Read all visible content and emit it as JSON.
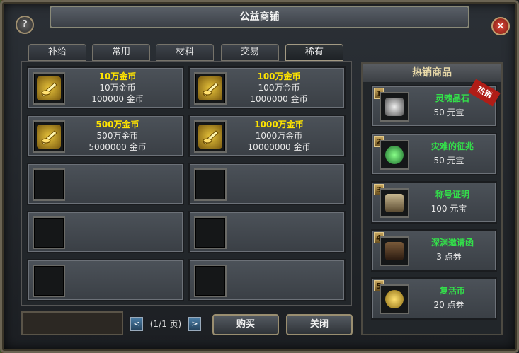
{
  "window": {
    "title": "公益商铺",
    "help_label": "?",
    "close_label": "✕"
  },
  "tabs": [
    {
      "label": "补给",
      "active": false
    },
    {
      "label": "常用",
      "active": false
    },
    {
      "label": "材料",
      "active": false
    },
    {
      "label": "交易",
      "active": false
    },
    {
      "label": "稀有",
      "active": true
    }
  ],
  "slots": [
    {
      "name": "10万金币",
      "sub": "10万金币",
      "price": "100000 金币",
      "icon": "gold-coin-icon"
    },
    {
      "name": "100万金币",
      "sub": "100万金币",
      "price": "1000000 金币",
      "icon": "gold-coin-icon"
    },
    {
      "name": "500万金币",
      "sub": "500万金币",
      "price": "5000000 金币",
      "icon": "gold-coin-icon"
    },
    {
      "name": "1000万金币",
      "sub": "1000万金币",
      "price": "10000000 金币",
      "icon": "gold-coin-icon"
    },
    {},
    {},
    {},
    {},
    {},
    {}
  ],
  "hot": {
    "title": "热销商品",
    "badge": "热销",
    "items": [
      {
        "rank": "1",
        "name": "灵魂晶石",
        "price": "50 元宝",
        "icon": "crystal-icon",
        "color": "#9aa1a8"
      },
      {
        "rank": "2",
        "name": "灾难的征兆",
        "price": "50 元宝",
        "icon": "green-orb-icon",
        "color": "#2fa84a"
      },
      {
        "rank": "3",
        "name": "称号证明",
        "price": "100 元宝",
        "icon": "anvil-icon",
        "color": "#8a7a58"
      },
      {
        "rank": "4",
        "name": "深渊邀请函",
        "price": "3 点券",
        "icon": "book-icon",
        "color": "#5a3a22"
      },
      {
        "rank": "5",
        "name": "复活币",
        "price": "20 点券",
        "icon": "revive-coin-icon",
        "color": "#d8b030"
      }
    ]
  },
  "pager": {
    "prev": "<",
    "text": "(1/1 页)",
    "next": ">"
  },
  "buttons": {
    "buy": "购买",
    "close": "关闭"
  }
}
